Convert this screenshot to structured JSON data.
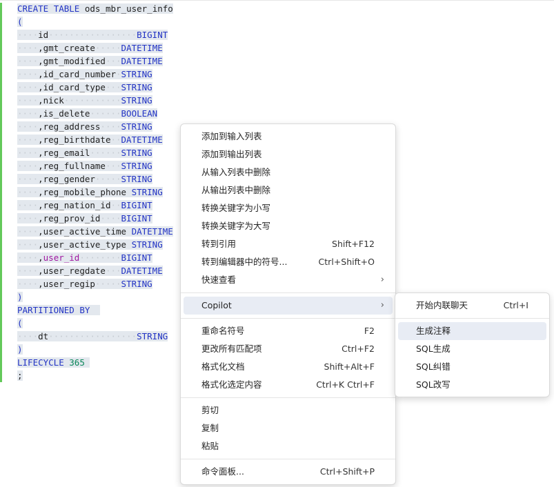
{
  "editor": {
    "lines": [
      {
        "parts": [
          {
            "t": "CREATE",
            "c": "kw"
          },
          {
            "t": " "
          },
          {
            "t": "TABLE",
            "c": "kw"
          },
          {
            "t": " "
          },
          {
            "t": "ods_mbr_user_info",
            "c": "id"
          }
        ]
      },
      {
        "parts": [
          {
            "t": "(",
            "c": "pn"
          }
        ]
      },
      {
        "parts": [
          {
            "t": "····",
            "c": "dots"
          },
          {
            "t": "id",
            "c": "id"
          },
          {
            "t": "·················",
            "c": "dots"
          },
          {
            "t": "BIGINT",
            "c": "ty"
          }
        ]
      },
      {
        "parts": [
          {
            "t": "····",
            "c": "dots"
          },
          {
            "t": ",gmt_create",
            "c": "id"
          },
          {
            "t": "·····",
            "c": "dots"
          },
          {
            "t": "DATETIME",
            "c": "ty"
          }
        ]
      },
      {
        "parts": [
          {
            "t": "····",
            "c": "dots"
          },
          {
            "t": ",gmt_modified",
            "c": "id"
          },
          {
            "t": "···",
            "c": "dots"
          },
          {
            "t": "DATETIME",
            "c": "ty"
          }
        ]
      },
      {
        "parts": [
          {
            "t": "····",
            "c": "dots"
          },
          {
            "t": ",id_card_number",
            "c": "id"
          },
          {
            "t": "·",
            "c": "dots"
          },
          {
            "t": "STRING",
            "c": "ty"
          }
        ]
      },
      {
        "parts": [
          {
            "t": "····",
            "c": "dots"
          },
          {
            "t": ",id_card_type",
            "c": "id"
          },
          {
            "t": "···",
            "c": "dots"
          },
          {
            "t": "STRING",
            "c": "ty"
          }
        ]
      },
      {
        "parts": [
          {
            "t": "····",
            "c": "dots"
          },
          {
            "t": ",nick",
            "c": "id"
          },
          {
            "t": "···········",
            "c": "dots"
          },
          {
            "t": "STRING",
            "c": "ty"
          }
        ]
      },
      {
        "parts": [
          {
            "t": "····",
            "c": "dots"
          },
          {
            "t": ",is_delete",
            "c": "id"
          },
          {
            "t": "······",
            "c": "dots"
          },
          {
            "t": "BOOLEAN",
            "c": "ty"
          }
        ]
      },
      {
        "parts": [
          {
            "t": "····",
            "c": "dots"
          },
          {
            "t": ",reg_address",
            "c": "id"
          },
          {
            "t": "····",
            "c": "dots"
          },
          {
            "t": "STRING",
            "c": "ty"
          }
        ]
      },
      {
        "parts": [
          {
            "t": "····",
            "c": "dots"
          },
          {
            "t": ",reg_birthdate",
            "c": "id"
          },
          {
            "t": "··",
            "c": "dots"
          },
          {
            "t": "DATETIME",
            "c": "ty"
          }
        ]
      },
      {
        "parts": [
          {
            "t": "····",
            "c": "dots"
          },
          {
            "t": ",reg_email",
            "c": "id"
          },
          {
            "t": "······",
            "c": "dots"
          },
          {
            "t": "STRING",
            "c": "ty"
          }
        ]
      },
      {
        "parts": [
          {
            "t": "····",
            "c": "dots"
          },
          {
            "t": ",reg_fullname",
            "c": "id"
          },
          {
            "t": "···",
            "c": "dots"
          },
          {
            "t": "STRING",
            "c": "ty"
          }
        ]
      },
      {
        "parts": [
          {
            "t": "····",
            "c": "dots"
          },
          {
            "t": ",reg_gender",
            "c": "id"
          },
          {
            "t": "·····",
            "c": "dots"
          },
          {
            "t": "STRING",
            "c": "ty"
          }
        ]
      },
      {
        "parts": [
          {
            "t": "····",
            "c": "dots"
          },
          {
            "t": ",reg_mobile_phone",
            "c": "id"
          },
          {
            "t": " "
          },
          {
            "t": "STRING",
            "c": "ty"
          }
        ]
      },
      {
        "parts": [
          {
            "t": "····",
            "c": "dots"
          },
          {
            "t": ",reg_nation_id",
            "c": "id"
          },
          {
            "t": "··",
            "c": "dots"
          },
          {
            "t": "BIGINT",
            "c": "ty"
          }
        ]
      },
      {
        "parts": [
          {
            "t": "····",
            "c": "dots"
          },
          {
            "t": ",reg_prov_id",
            "c": "id"
          },
          {
            "t": "····",
            "c": "dots"
          },
          {
            "t": "BIGINT",
            "c": "ty"
          }
        ]
      },
      {
        "parts": [
          {
            "t": "····",
            "c": "dots"
          },
          {
            "t": ",user_active_time",
            "c": "id"
          },
          {
            "t": " "
          },
          {
            "t": "DATETIME",
            "c": "ty"
          }
        ]
      },
      {
        "parts": [
          {
            "t": "····",
            "c": "dots"
          },
          {
            "t": ",user_active_type",
            "c": "id"
          },
          {
            "t": " "
          },
          {
            "t": "STRING",
            "c": "ty"
          }
        ]
      },
      {
        "parts": [
          {
            "t": "····",
            "c": "dots"
          },
          {
            "t": ",",
            "c": "id"
          },
          {
            "t": "user_id",
            "c": "hl"
          },
          {
            "t": "········",
            "c": "dots"
          },
          {
            "t": "BIGINT",
            "c": "ty"
          }
        ]
      },
      {
        "parts": [
          {
            "t": "····",
            "c": "dots"
          },
          {
            "t": ",user_regdate",
            "c": "id"
          },
          {
            "t": "···",
            "c": "dots"
          },
          {
            "t": "DATETIME",
            "c": "ty"
          }
        ]
      },
      {
        "parts": [
          {
            "t": "····",
            "c": "dots"
          },
          {
            "t": ",user_regip",
            "c": "id"
          },
          {
            "t": "·····",
            "c": "dots"
          },
          {
            "t": "STRING",
            "c": "ty"
          }
        ]
      },
      {
        "parts": [
          {
            "t": ")",
            "c": "pn"
          }
        ]
      },
      {
        "parts": [
          {
            "t": "PARTITIONED",
            "c": "kw"
          },
          {
            "t": " "
          },
          {
            "t": "BY",
            "c": "kw"
          },
          {
            "t": "  "
          }
        ]
      },
      {
        "parts": [
          {
            "t": "(",
            "c": "pn"
          }
        ]
      },
      {
        "parts": [
          {
            "t": "····",
            "c": "dots"
          },
          {
            "t": "dt",
            "c": "id"
          },
          {
            "t": "·················",
            "c": "dots"
          },
          {
            "t": "STRING",
            "c": "ty"
          }
        ]
      },
      {
        "parts": [
          {
            "t": ")",
            "c": "pn"
          }
        ]
      },
      {
        "parts": [
          {
            "t": "LIFECYCLE",
            "c": "kw"
          },
          {
            "t": " "
          },
          {
            "t": "365",
            "c": "num"
          },
          {
            "t": " "
          }
        ]
      },
      {
        "parts": [
          {
            "t": ";",
            "c": "id"
          }
        ]
      }
    ]
  },
  "context_menu": {
    "groups": [
      [
        {
          "label": "添加到输入列表",
          "shortcut": ""
        },
        {
          "label": "添加到输出列表",
          "shortcut": ""
        },
        {
          "label": "从输入列表中删除",
          "shortcut": ""
        },
        {
          "label": "从输出列表中删除",
          "shortcut": ""
        },
        {
          "label": "转换关键字为小写",
          "shortcut": ""
        },
        {
          "label": "转换关键字为大写",
          "shortcut": ""
        },
        {
          "label": "转到引用",
          "shortcut": "Shift+F12"
        },
        {
          "label": "转到编辑器中的符号...",
          "shortcut": "Ctrl+Shift+O"
        },
        {
          "label": "快速查看",
          "shortcut": "",
          "submenu": true
        }
      ],
      [
        {
          "label": "Copilot",
          "shortcut": "",
          "submenu": true,
          "active": true
        }
      ],
      [
        {
          "label": "重命名符号",
          "shortcut": "F2"
        },
        {
          "label": "更改所有匹配项",
          "shortcut": "Ctrl+F2"
        },
        {
          "label": "格式化文档",
          "shortcut": "Shift+Alt+F"
        },
        {
          "label": "格式化选定内容",
          "shortcut": "Ctrl+K Ctrl+F"
        }
      ],
      [
        {
          "label": "剪切",
          "shortcut": ""
        },
        {
          "label": "复制",
          "shortcut": ""
        },
        {
          "label": "粘贴",
          "shortcut": ""
        }
      ],
      [
        {
          "label": "命令面板...",
          "shortcut": "Ctrl+Shift+P"
        }
      ]
    ]
  },
  "copilot_submenu": {
    "groups": [
      [
        {
          "label": "开始内联聊天",
          "shortcut": "Ctrl+I"
        }
      ],
      [
        {
          "label": "生成注释",
          "shortcut": "",
          "active": true
        },
        {
          "label": "SQL生成",
          "shortcut": ""
        },
        {
          "label": "SQL纠错",
          "shortcut": ""
        },
        {
          "label": "SQL改写",
          "shortcut": ""
        }
      ]
    ]
  },
  "colors": {
    "accent_green": "#63c95a",
    "selection": "#e3e8ee",
    "keyword": "#2233c4",
    "menu_active": "#e8ecf4"
  }
}
